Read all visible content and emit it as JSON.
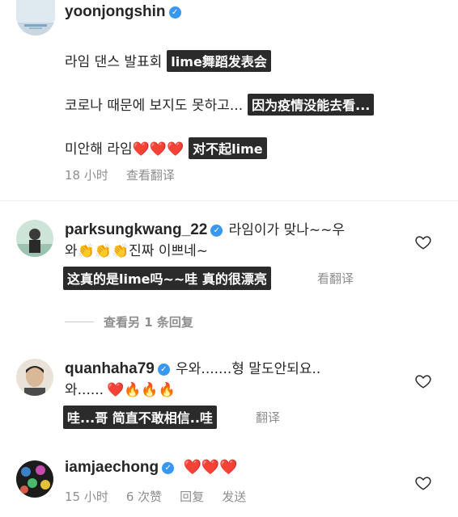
{
  "comments": [
    {
      "username": "yoonjongshin",
      "lines": [
        {
          "text": "라임 댄스 발표회",
          "translation": "lime舞蹈发表会"
        },
        {
          "text": "코로나 때문에 보지도 못하고...",
          "translation": "因为疫情没能去看..."
        },
        {
          "text": "미안해 라임",
          "emoji": "❤️❤️❤️",
          "translation": "对不起lime"
        }
      ],
      "time": "18 小时",
      "see_translation": "查看翻译"
    },
    {
      "username": "parksungkwang_22",
      "line1": "라임이가 맞나~~우",
      "line2_pre": "와",
      "line2_emoji": "👏👏👏",
      "line2_post": "진짜 이쁘네~",
      "translation": "这真的是lime吗~~哇 真的很漂亮",
      "see_translation_faded": "看翻译",
      "view_replies": "查看另 1 条回复"
    },
    {
      "username": "quanhaha79",
      "line1": "우와.......형 말도안되요..",
      "line2_pre": "와......",
      "line2_emoji": "❤️🔥🔥🔥",
      "translation": "哇...哥  简直不敢相信..哇",
      "see_translation_faded": "翻译"
    },
    {
      "username": "iamjaechong",
      "emoji": "❤️❤️❤️",
      "time": "15 小时",
      "likes": "6 次赞",
      "reply": "回复",
      "send": "发送"
    }
  ],
  "colors": {
    "verified": "#3897f0",
    "text": "#262626",
    "muted": "#8e8e8e",
    "tag_bg": "#2b2b2b"
  },
  "icons": [
    "verified-badge-icon",
    "heart-outline-icon"
  ]
}
